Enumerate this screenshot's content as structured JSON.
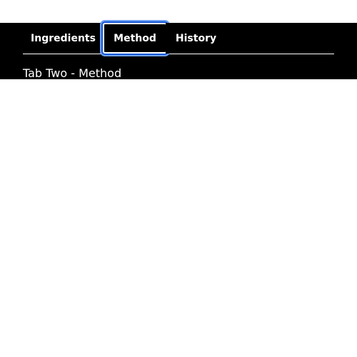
{
  "tabs": [
    {
      "label": "Ingredients",
      "selected": false
    },
    {
      "label": "Method",
      "selected": true
    },
    {
      "label": "History",
      "selected": false
    }
  ],
  "panel": {
    "text": "Tab Two - Method"
  },
  "colors": {
    "background": "#000000",
    "text": "#ffffff",
    "focus_ring_inner": "#1558d6",
    "focus_ring_outer": "#6ea0f2"
  }
}
